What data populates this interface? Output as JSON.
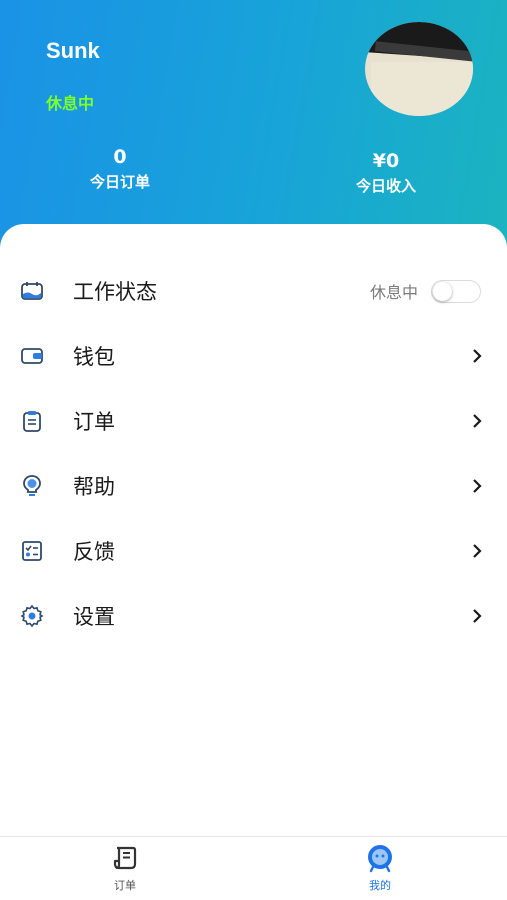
{
  "header": {
    "username": "Sunk",
    "status": "休息中",
    "stats": [
      {
        "value": "0",
        "label": "今日订单"
      },
      {
        "value": "¥0",
        "label": "今日收入"
      }
    ]
  },
  "menu": {
    "items": [
      {
        "label": "工作状态",
        "icon": "work-status-icon"
      },
      {
        "label": "钱包",
        "icon": "wallet-icon"
      },
      {
        "label": "订单",
        "icon": "clipboard-icon"
      },
      {
        "label": "帮助",
        "icon": "lightbulb-icon"
      },
      {
        "label": "反馈",
        "icon": "checklist-icon"
      },
      {
        "label": "设置",
        "icon": "gear-icon"
      }
    ],
    "work_status_toggle": {
      "label": "休息中",
      "on": false
    }
  },
  "tabbar": {
    "tabs": [
      {
        "label": "订单",
        "icon": "orders-icon",
        "active": false
      },
      {
        "label": "我的",
        "icon": "profile-icon",
        "active": true
      }
    ]
  },
  "colors": {
    "header_start": "#1a92e6",
    "header_end": "#1bb4bf",
    "status_green": "#7cff2a",
    "accent_blue": "#1e73e8"
  }
}
